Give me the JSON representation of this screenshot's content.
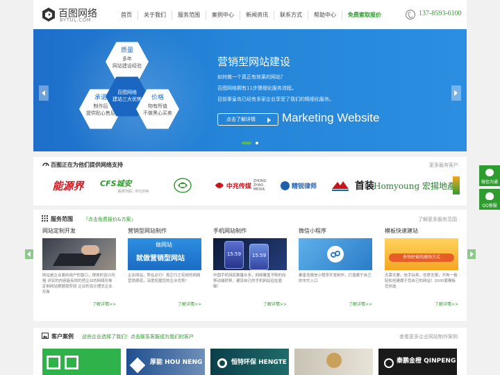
{
  "header": {
    "logo_name": "百图网络",
    "logo_sub": "BYTUL.COM",
    "nav": [
      "首页",
      "关于我们",
      "服务范围",
      "案例中心",
      "新闻资讯",
      "联系方式",
      "帮助中心",
      "免费索取报价"
    ],
    "phone": "137-8593-6100"
  },
  "banner": {
    "hex_top": {
      "title": "质量",
      "l1": "多年",
      "l2": "网站建设经验"
    },
    "hex_left": {
      "title": "承诺",
      "l1": "制作后",
      "l2": "提供贴心售后"
    },
    "hex_mid": {
      "l1": "百图网络",
      "l2": "建站三大优势"
    },
    "hex_right": {
      "title": "价格",
      "l1": "物有所值",
      "l2": "不做黑心买卖"
    },
    "title": "营销型网站建设",
    "line1": "如何做一个真正有效果的网站？",
    "line2": "百图网络拥有11步骤细化服务流程。",
    "line3": "目前秦皇岛已经有多家企业享受了我们的精细化服务。",
    "button": "点击了解详情",
    "english": "Marketing Website"
  },
  "partners": {
    "title": "百图正在为他们提供网络支持",
    "more": "更多服务客户",
    "logos": [
      "能源界",
      "CFS城安",
      "",
      "中兆传媒",
      "精锐律师",
      "",
      "首装",
      "Homyoung 宏揚地產"
    ],
    "cfs_sub": "股票代码：872399",
    "zhongzhao_en": "ZHONG ZHAO MEDIA"
  },
  "services": {
    "title": "服务范围",
    "promo": "『点击免费报价&方案』",
    "more": "了解更多服务范围",
    "items": [
      {
        "title": "网站定制开发",
        "desc": "网站是企业面向用户的窗口，律体的设计风格 详实的内容能有效的把企业的网络形象 定制网站根据现阶段 企业的设计理念企业形象",
        "link": "了解详情>>"
      },
      {
        "title": "营销型网站制作",
        "desc": "企业网站，势在必行！真正行之有效的网络营销渠道，深度挖掘您的企业优势！",
        "link": "了解详情>>",
        "img_l1": "做网站",
        "img_l2": "就做营销型网站"
      },
      {
        "title": "手机网站制作",
        "desc": "中国手机网民数量众多，网络覆盖不断的向移动端转移，建设自己的手机网站迫在眉睫！",
        "link": "了解详情>>",
        "time1": "15:59",
        "time2": "15:59"
      },
      {
        "title": "微信小程序",
        "desc": "秦皇岛微信小程序开发制作，打造属于自己的中文入口",
        "link": "了解详情>>"
      },
      {
        "title": "模板快速建站",
        "desc": "无需无要，信手拈来，创意无限，不拘一格 轻松创建属于您自己的网站！2000套模板任你选",
        "link": "了解详情>>",
        "img_label": "多快好省的建站方式"
      }
    ]
  },
  "cases": {
    "title": "客户案例",
    "promo": "这些企业选择了我们！点击联系客服成为我们的客户",
    "more": "查看更多企业网站制作案例",
    "items": [
      "",
      "厚能 HOU NENG",
      "恒特环保 HENGTE E.P",
      "",
      "秦鹏金橙 QINPENG JINYAO"
    ]
  },
  "float": {
    "wechat": "微信沟通",
    "qq": "QQ客服"
  },
  "colors": {
    "accent": "#2e9c2e",
    "banner": "#2585d8"
  }
}
